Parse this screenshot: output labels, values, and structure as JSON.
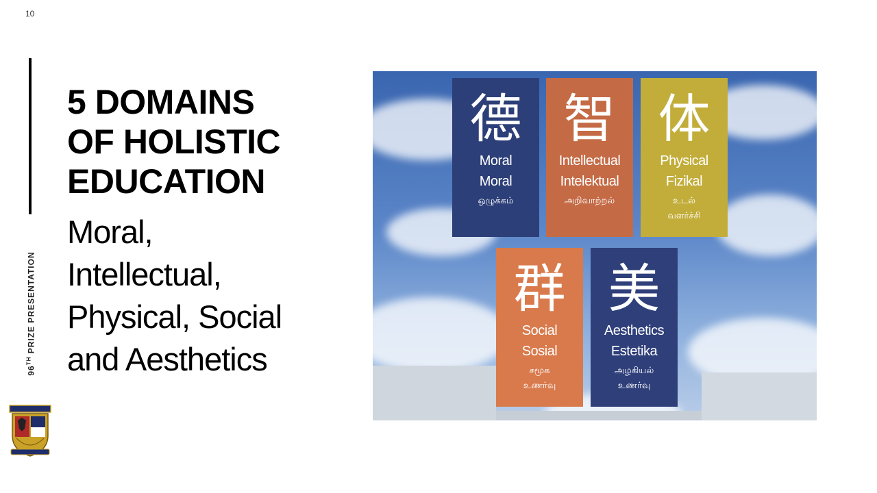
{
  "slide": {
    "number": "10",
    "caption_prefix": "96",
    "caption_sup": "TH",
    "caption_rest": " PRIZE PRESENTATION"
  },
  "title": [
    "5 DOMAINS",
    "OF HOLISTIC",
    "EDUCATION"
  ],
  "subtitle": [
    "Moral,",
    "Intellectual,",
    "Physical, Social",
    "and Aesthetics"
  ],
  "banners": [
    {
      "char": "德",
      "en1": "Moral",
      "en2": "Moral",
      "ta1": "ஒழுக்கம்",
      "ta2": "",
      "color": "#2d3f78"
    },
    {
      "char": "智",
      "en1": "Intellectual",
      "en2": "Intelektual",
      "ta1": "அறிவாற்றல்",
      "ta2": "",
      "color": "#c46a45"
    },
    {
      "char": "体",
      "en1": "Physical",
      "en2": "Fizikal",
      "ta1": "உடல்",
      "ta2": "வளர்ச்சி",
      "color": "#c2ad3a"
    },
    {
      "char": "群",
      "en1": "Social",
      "en2": "Sosial",
      "ta1": "சமூக",
      "ta2": "உணர்வு",
      "color": "#d97a4c"
    },
    {
      "char": "美",
      "en1": "Aesthetics",
      "en2": "Estetika",
      "ta1": "அழகியல்",
      "ta2": "உணர்வு",
      "color": "#2f3f7a"
    }
  ]
}
